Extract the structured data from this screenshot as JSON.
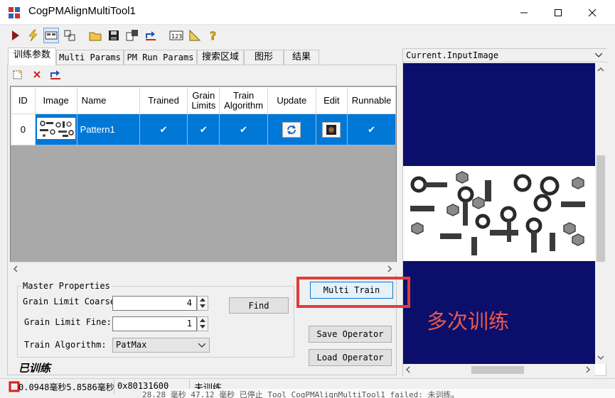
{
  "window": {
    "title": "CogPMAlignMultiTool1"
  },
  "tabs": [
    {
      "label": "训练参数",
      "active": true
    },
    {
      "label": "Multi Params",
      "active": false
    },
    {
      "label": "PM Run Params",
      "active": false
    },
    {
      "label": "搜索区域",
      "active": false
    },
    {
      "label": "图形",
      "active": false
    },
    {
      "label": "结果",
      "active": false
    }
  ],
  "grid": {
    "columns": [
      "ID",
      "Image",
      "Name",
      "Trained",
      "Grain Limits",
      "Train Algorithm",
      "Update",
      "Edit",
      "Runnable"
    ],
    "rows": [
      {
        "id": "0",
        "name": "Pattern1",
        "trained": "✔",
        "grain_limits": "✔",
        "train_algorithm": "✔",
        "runnable": "✔"
      }
    ]
  },
  "master": {
    "legend": "Master Properties",
    "coarse_label": "Grain Limit Coarse:",
    "coarse_value": "4",
    "fine_label": "Grain Limit Fine:",
    "fine_value": "1",
    "algorithm_label": "Train Algorithm:",
    "algorithm_value": "PatMax",
    "find_label": "Find"
  },
  "buttons": {
    "multi_train": "Multi Train",
    "save_operator": "Save Operator",
    "load_operator": "Load Operator"
  },
  "image_panel": {
    "selected_image": "Current.InputImage"
  },
  "trained_state": "已训练",
  "status": {
    "timing": "0.0948毫秒5.8586毫秒",
    "code": "0x80131600",
    "message": "未训练。"
  },
  "background_text": "28.28 毫秒    47.12 毫秒    已停止          Tool  CogPMAlignMultiTool1  failed: 未训练。",
  "annotation": "多次训练",
  "colors": {
    "selection": "#0078d7",
    "image_background": "#0c0e6b",
    "annotation_red": "#e03c3c"
  }
}
